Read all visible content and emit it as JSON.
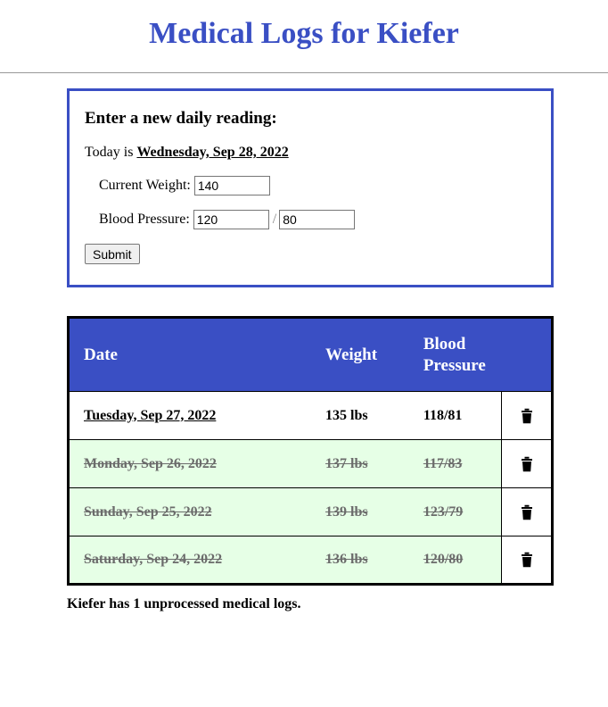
{
  "header": {
    "title": "Medical Logs for Kiefer"
  },
  "form": {
    "heading": "Enter a new daily reading:",
    "today_prefix": "Today is",
    "today_date": "Wednesday, Sep 28, 2022",
    "weight_label": "Current Weight:",
    "weight_value": "140",
    "bp_label": "Blood Pressure:",
    "bp_systolic_value": "120",
    "bp_separator": "/",
    "bp_diastolic_value": "80",
    "submit_label": "Submit"
  },
  "table": {
    "columns": [
      "Date",
      "Weight",
      "Blood Pressure",
      ""
    ],
    "rows": [
      {
        "date": "Tuesday, Sep 27, 2022",
        "weight": "135 lbs",
        "bp": "118/81",
        "processed": false,
        "action_icon": "trash-icon"
      },
      {
        "date": "Monday, Sep 26, 2022",
        "weight": "137 lbs",
        "bp": "117/83",
        "processed": true,
        "action_icon": "trash-icon"
      },
      {
        "date": "Sunday, Sep 25, 2022",
        "weight": "139 lbs",
        "bp": "123/79",
        "processed": true,
        "action_icon": "trash-icon"
      },
      {
        "date": "Saturday, Sep 24, 2022",
        "weight": "136 lbs",
        "bp": "120/80",
        "processed": true,
        "action_icon": "trash-icon"
      }
    ]
  },
  "footer": {
    "summary": "Kiefer has 1 unprocessed medical logs."
  },
  "colors": {
    "accent": "#3a4fc4",
    "processed_row_bg": "#e6ffe6"
  }
}
